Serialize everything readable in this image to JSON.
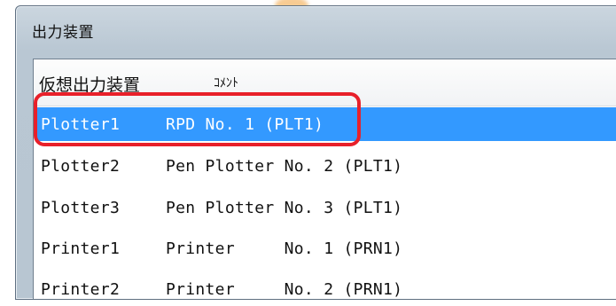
{
  "window": {
    "title": "出力装置"
  },
  "list": {
    "columns": [
      "仮想出力装置",
      "ｺﾒﾝﾄ"
    ],
    "selected_index": 0,
    "rows": [
      {
        "name": "Plotter1",
        "comment": "RPD No. 1 (PLT1)"
      },
      {
        "name": "Plotter2",
        "comment": "Pen Plotter No. 2 (PLT1)"
      },
      {
        "name": "Plotter3",
        "comment": "Pen Plotter No. 3 (PLT1)"
      },
      {
        "name": "Printer1",
        "comment": "Printer     No. 1 (PRN1)"
      },
      {
        "name": "Printer2",
        "comment": "Printer     No. 2 (PRN1)"
      }
    ]
  },
  "colors": {
    "selection": "#3399ff",
    "highlight": "#e8202a"
  }
}
